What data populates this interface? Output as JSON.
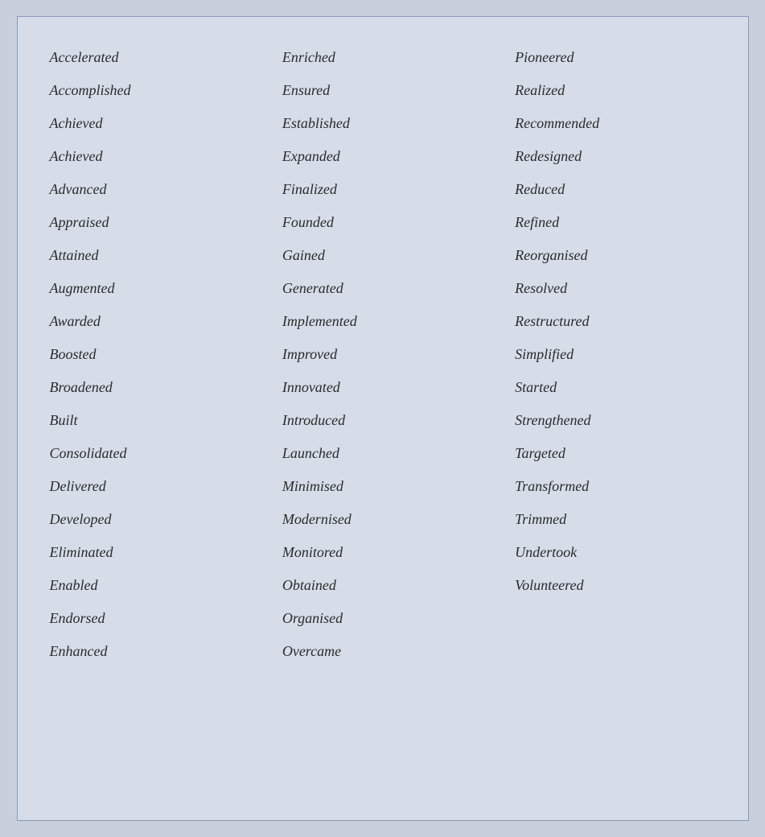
{
  "columns": [
    [
      "Accelerated",
      "Accomplished",
      "Achieved",
      "Achieved",
      "Advanced",
      "Appraised",
      "Attained",
      "Augmented",
      "Awarded",
      "Boosted",
      "Broadened",
      "Built",
      "Consolidated",
      "Delivered",
      "Developed",
      "Eliminated",
      "Enabled",
      "Endorsed",
      "Enhanced"
    ],
    [
      "Enriched",
      "Ensured",
      "Established",
      "Expanded",
      "Finalized",
      "Founded",
      "Gained",
      "Generated",
      "Implemented",
      "Improved",
      "Innovated",
      "Introduced",
      "Launched",
      "Minimised",
      "Modernised",
      "Monitored",
      "Obtained",
      "Organised",
      "Overcame"
    ],
    [
      "Pioneered",
      "Realized",
      "Recommended",
      "Redesigned",
      "Reduced",
      "Refined",
      "Reorganised",
      "Resolved",
      "Restructured",
      "Simplified",
      "Started",
      "Strengthened",
      "Targeted",
      "Transformed",
      "Trimmed",
      "Undertook",
      "Volunteered",
      "",
      ""
    ]
  ]
}
